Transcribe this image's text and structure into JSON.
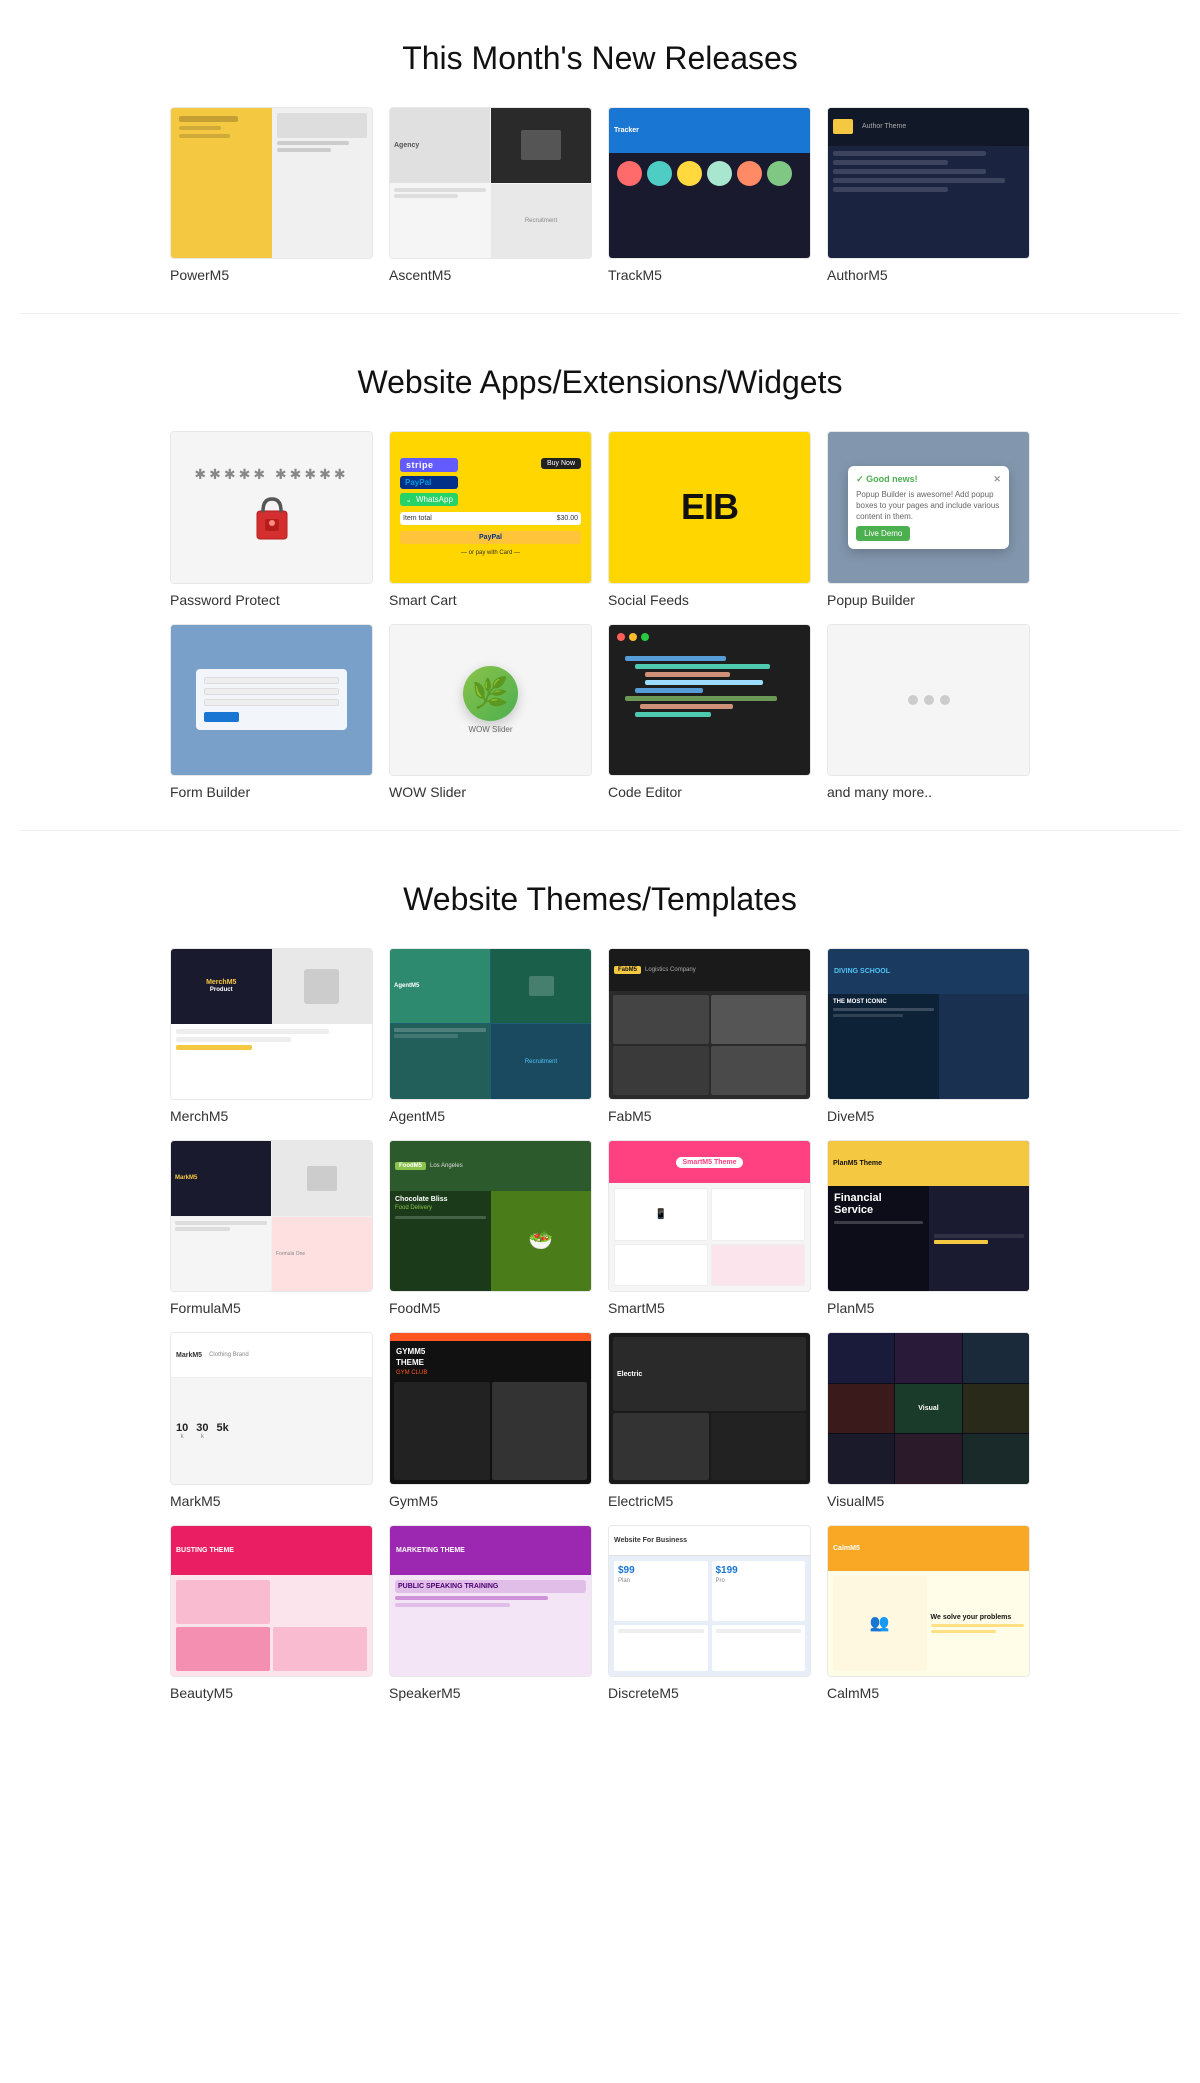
{
  "sections": {
    "new_releases": {
      "title": "This Month's New Releases",
      "items": [
        {
          "id": "powerm5",
          "label": "PowerM5"
        },
        {
          "id": "ascentm5",
          "label": "AscentM5"
        },
        {
          "id": "trackm5",
          "label": "TrackM5"
        },
        {
          "id": "authorm5",
          "label": "AuthorM5"
        }
      ]
    },
    "extensions": {
      "title": "Website Apps/Extensions/Widgets",
      "row1": [
        {
          "id": "password-protect",
          "label": "Password Protect"
        },
        {
          "id": "smart-cart",
          "label": "Smart Cart"
        },
        {
          "id": "social-feeds",
          "label": "Social Feeds"
        },
        {
          "id": "popup-builder",
          "label": "Popup Builder"
        }
      ],
      "row2": [
        {
          "id": "form-builder",
          "label": "Form Builder"
        },
        {
          "id": "wow-slider",
          "label": "WOW Slider"
        },
        {
          "id": "code-editor",
          "label": "Code Editor"
        },
        {
          "id": "and-more",
          "label": "and many more.."
        }
      ]
    },
    "themes": {
      "title": "Website Themes/Templates",
      "row1": [
        {
          "id": "merchm5",
          "label": "MerchM5"
        },
        {
          "id": "agentm5",
          "label": "AgentM5"
        },
        {
          "id": "fabm5",
          "label": "FabM5"
        },
        {
          "id": "divem5",
          "label": "DiveM5"
        }
      ],
      "row2": [
        {
          "id": "formulam5",
          "label": "FormulaM5"
        },
        {
          "id": "foodm5",
          "label": "FoodM5"
        },
        {
          "id": "smartm5",
          "label": "SmartM5"
        },
        {
          "id": "planm5",
          "label": "PlanM5"
        }
      ],
      "row3": [
        {
          "id": "markm5",
          "label": "MarkM5"
        },
        {
          "id": "gymm5",
          "label": "GymM5"
        },
        {
          "id": "electricm5",
          "label": "ElectricM5"
        },
        {
          "id": "visualm5",
          "label": "VisualM5"
        }
      ],
      "row4": [
        {
          "id": "beautym5",
          "label": "BeautyM5"
        },
        {
          "id": "speakerm5",
          "label": "SpeakerM5"
        },
        {
          "id": "discretem5",
          "label": "DiscreteM5"
        },
        {
          "id": "calmm5",
          "label": "CalmM5"
        }
      ]
    }
  },
  "widgets": {
    "stripe_label": "stripe",
    "paypal_label": "PayPal",
    "whatsapp_label": "WhatsApp",
    "buy_now": "Buy Now",
    "eib_text": "EIB",
    "good_news": "Good news!",
    "live_demo": "Live Demo",
    "popup_text": "Popup Builder is awesome! Add popup boxes to your pages and include various content in them.",
    "dots": [
      "•",
      "•",
      "•"
    ]
  },
  "themes_extra": {
    "merch_badge": "MerchM5",
    "fab_badge": "FabM5",
    "gym_text": "GYM CLUB",
    "plan_badge": "PlanM5 Theme",
    "smart_badge": "SmartM5 Theme",
    "beauty_text": "BUSTING THEME",
    "speaker_text": "PUBLIC SPEAKING TRAINING",
    "discrete_text": "Website For Business",
    "calm_text": "We solve your problems"
  }
}
